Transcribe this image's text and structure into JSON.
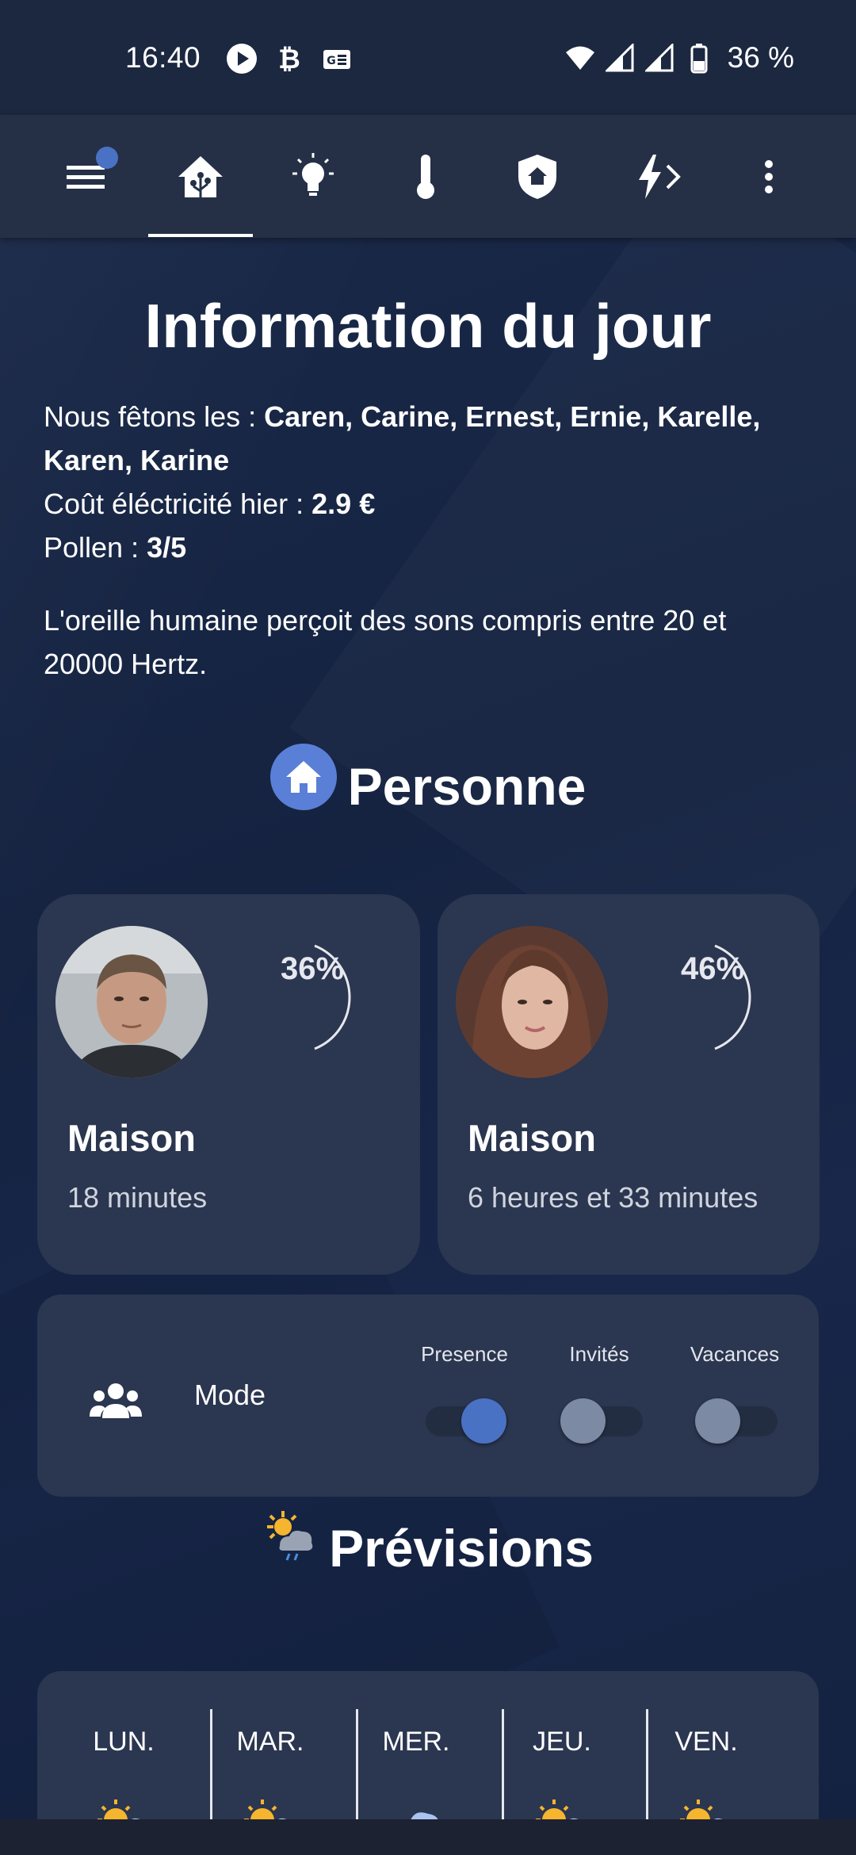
{
  "status_bar": {
    "time": "16:40",
    "battery_text": "36 %",
    "left_icons": [
      "play-icon",
      "bitcoin-icon",
      "news-icon"
    ],
    "right_icons": [
      "wifi-icon",
      "signal-icon",
      "signal-icon",
      "battery-icon"
    ]
  },
  "toolbar": {
    "tabs": [
      "menu",
      "home",
      "lights",
      "temperature",
      "security",
      "energy"
    ],
    "active_tab": "home"
  },
  "info": {
    "title": "Information du jour",
    "names_label": "Nous fêtons les : ",
    "names_value": "Caren, Carine, Ernest, Ernie, Karelle, Karen, Karine",
    "elec_label": "Coût éléctricité hier : ",
    "elec_value": "2.9 €",
    "pollen_label": "Pollen : ",
    "pollen_value": "3/5",
    "fact": "L'oreille humaine perçoit des sons compris entre 20 et 20000 Hertz."
  },
  "personne": {
    "title": "Personne",
    "people": [
      {
        "battery": "36%",
        "battery_value": 36,
        "state": "Maison",
        "duration": "18 minutes"
      },
      {
        "battery": "46%",
        "battery_value": 46,
        "state": "Maison",
        "duration": "6 heures et 33 minutes"
      }
    ]
  },
  "mode": {
    "label": "Mode",
    "switches": [
      {
        "label": "Presence",
        "on": true
      },
      {
        "label": "Invités",
        "on": false
      },
      {
        "label": "Vacances",
        "on": false
      }
    ]
  },
  "previsions": {
    "title": "Prévisions",
    "days": [
      {
        "label": "LUN.",
        "icon": "partly-sunny-icon"
      },
      {
        "label": "MAR.",
        "icon": "partly-sunny-icon"
      },
      {
        "label": "MER.",
        "icon": "cloud-icon"
      },
      {
        "label": "JEU.",
        "icon": "partly-sunny-icon"
      },
      {
        "label": "VEN.",
        "icon": "partly-sunny-icon"
      }
    ]
  },
  "colors": {
    "background": "#172543",
    "card": "#2b3650",
    "accent": "#4a72c4",
    "toolbar": "#253047"
  }
}
